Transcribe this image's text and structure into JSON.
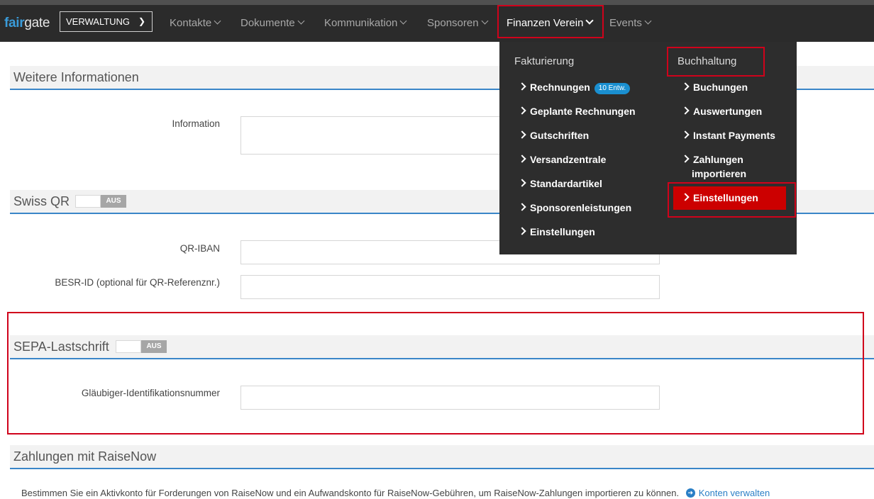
{
  "app": {
    "logo_part1": "fair",
    "logo_part2": "gate",
    "context_selector": "VERWALTUNG"
  },
  "nav": {
    "items": [
      {
        "label": "Kontakte"
      },
      {
        "label": "Dokumente"
      },
      {
        "label": "Kommunikation"
      },
      {
        "label": "Sponsoren"
      },
      {
        "label": "Finanzen Verein",
        "active": true
      },
      {
        "label": "Events"
      }
    ]
  },
  "dropdown": {
    "col1": {
      "heading": "Fakturierung",
      "items": [
        {
          "label": "Rechnungen",
          "badge": "10 Entw."
        },
        {
          "label": "Geplante Rechnungen"
        },
        {
          "label": "Gutschriften"
        },
        {
          "label": "Versandzentrale"
        },
        {
          "label": "Standardartikel"
        },
        {
          "label": "Sponsorenleistungen"
        },
        {
          "label": "Einstellungen"
        }
      ]
    },
    "col2": {
      "heading": "Buchhaltung",
      "items": [
        {
          "label": "Buchungen"
        },
        {
          "label": "Auswertungen"
        },
        {
          "label": "Instant Payments"
        },
        {
          "label_line1": "Zahlungen",
          "label_line2": "importieren"
        },
        {
          "label": "Einstellungen",
          "highlighted": true
        }
      ]
    }
  },
  "sections": {
    "weitere": {
      "title": "Weitere Informationen",
      "field_label": "Information"
    },
    "swissqr": {
      "title": "Swiss QR",
      "toggle_state": "AUS",
      "fields": [
        {
          "label": "QR-IBAN"
        },
        {
          "label": "BESR-ID (optional für QR-Referenznr.)"
        }
      ]
    },
    "sepa": {
      "title": "SEPA-Lastschrift",
      "toggle_state": "AUS",
      "field_label": "Gläubiger-Identifikationsnummer"
    },
    "raisenow": {
      "title": "Zahlungen mit RaiseNow",
      "description": "Bestimmen Sie ein Aktivkonto für Forderungen von RaiseNow und ein Aufwandskonto für RaiseNow-Gebühren, um RaiseNow-Zahlungen importieren zu können.",
      "link": "Konten verwalten"
    }
  },
  "colors": {
    "accent_blue": "#3a86c8",
    "highlight_red": "#cc0000",
    "annotation_red": "#d0021b",
    "navbar": "#2b2b2b"
  }
}
